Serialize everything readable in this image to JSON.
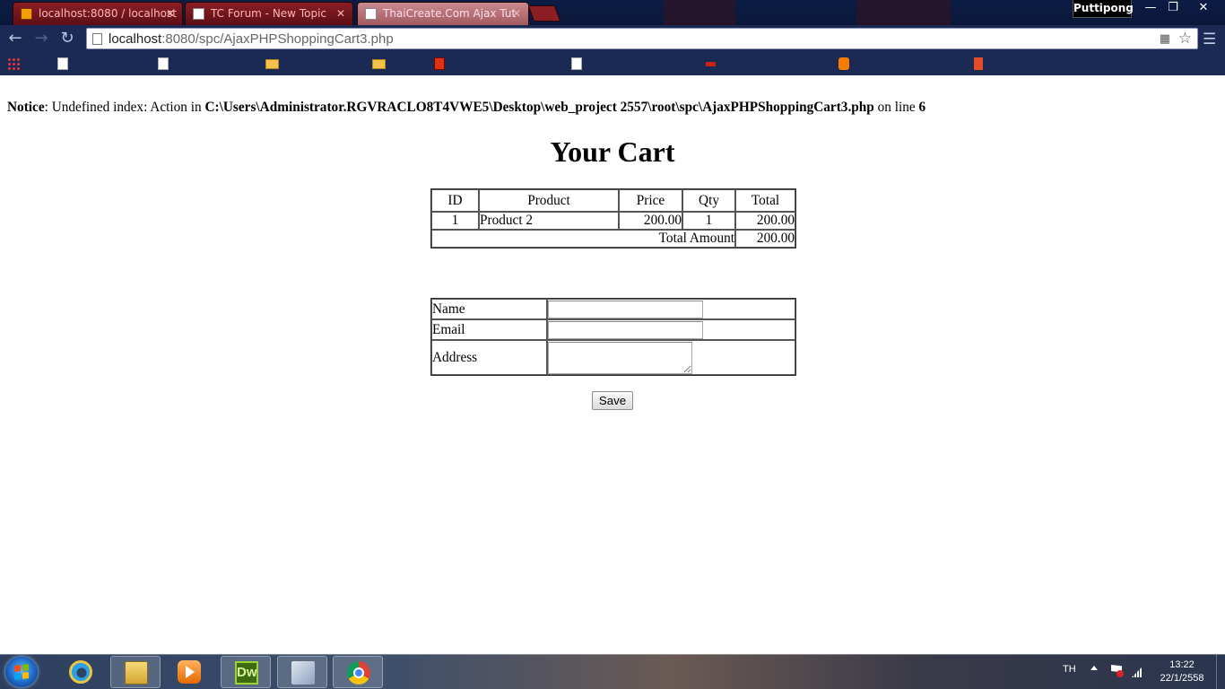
{
  "browser": {
    "tabs": [
      {
        "label": "localhost:8080 / localhost",
        "favicon": "phpmyadmin-icon"
      },
      {
        "label": "TC Forum - New Topic",
        "favicon": "page-icon"
      },
      {
        "label": "ThaiCreate.Com Ajax Tut",
        "favicon": "page-icon"
      }
    ],
    "user": "Puttipong",
    "window_controls": {
      "minimize": "—",
      "restore": "❐",
      "close": "✕"
    },
    "url_host": "localhost",
    "url_rest": ":8080/spc/AjaxPHPShoppingCart3.php"
  },
  "page": {
    "notice": {
      "label": "Notice",
      "text": ": Undefined index: Action in ",
      "path": "C:\\Users\\Administrator.RGVRACLO8T4VWE5\\Desktop\\web_project 2557\\root\\spc\\AjaxPHPShoppingCart3.php",
      "on_line": " on line ",
      "line": "6"
    },
    "title": "Your Cart",
    "cart": {
      "headers": [
        "ID",
        "Product",
        "Price",
        "Qty",
        "Total"
      ],
      "rows": [
        {
          "id": "1",
          "product": "Product 2",
          "price": "200.00",
          "qty": "1",
          "total": "200.00"
        }
      ],
      "total_label": "Total Amount",
      "total_value": "200.00"
    },
    "form": {
      "name_label": "Name",
      "email_label": "Email",
      "address_label": "Address",
      "name_value": "",
      "email_value": "",
      "address_value": ""
    },
    "save_label": "Save"
  },
  "taskbar": {
    "lang": "TH",
    "time": "13:22",
    "date": "22/1/2558",
    "dw_label": "Dw"
  }
}
